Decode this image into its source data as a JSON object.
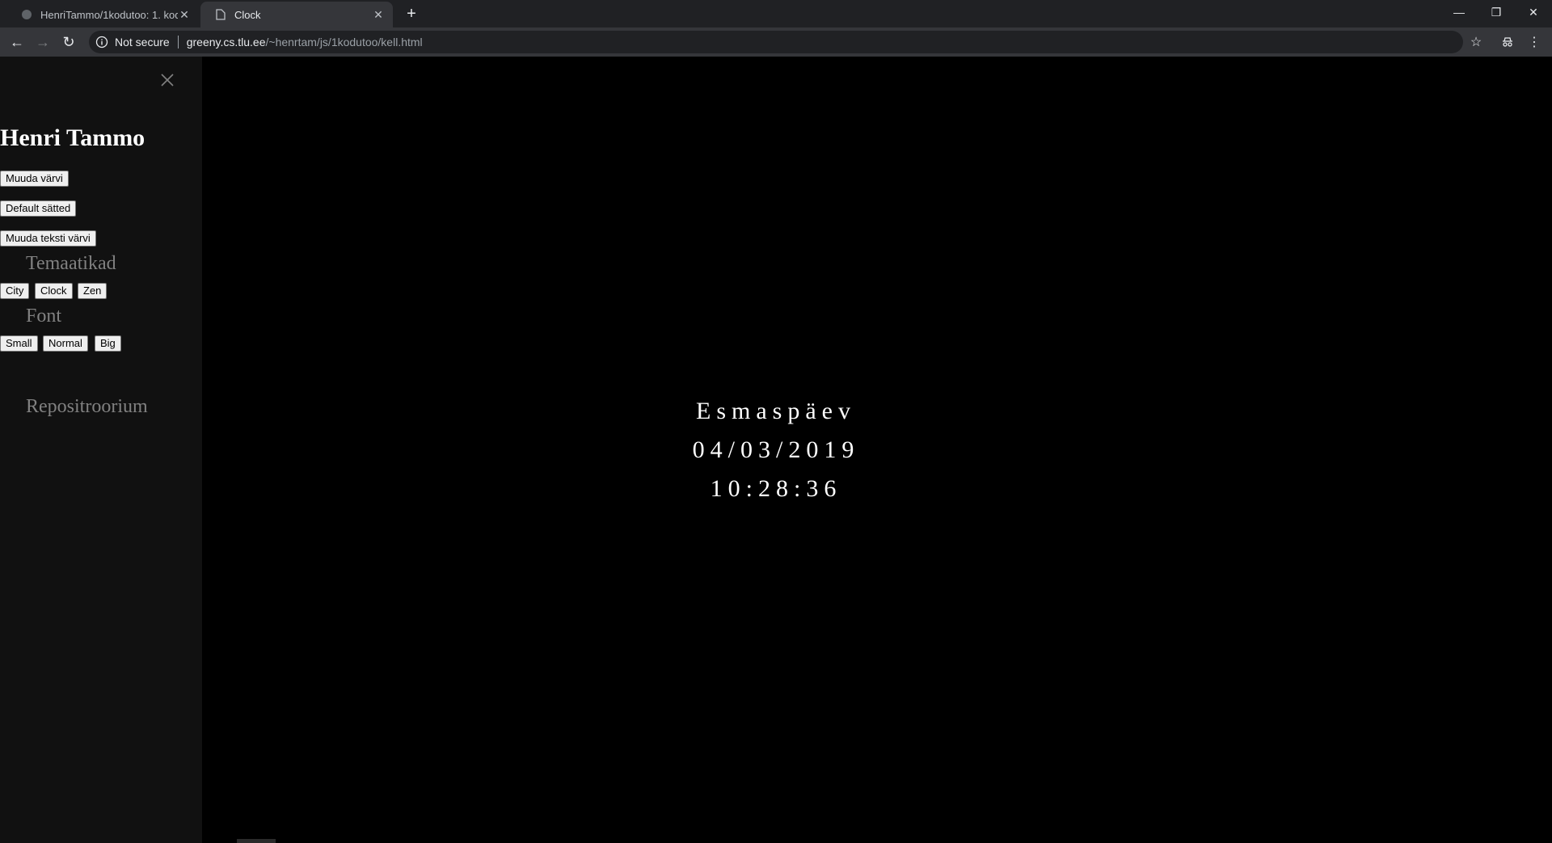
{
  "browser": {
    "tabs": [
      {
        "title": "HenriTammo/1kodutoo: 1. kodut",
        "active": false
      },
      {
        "title": "Clock",
        "active": true
      }
    ],
    "address": {
      "security": "Not secure",
      "host": "greeny.cs.tlu.ee",
      "path": "/~henrtam/js/1kodutoo/kell.html"
    }
  },
  "sidebar": {
    "name": "Henri Tammo",
    "buttons": {
      "change_color": "Muuda värvi",
      "default": "Default sätted",
      "change_text_color": "Muuda teksti värvi"
    },
    "themes_heading": "Temaatikad",
    "themes": [
      "City",
      "Clock",
      "Zen"
    ],
    "font_heading": "Font",
    "fonts": [
      "Small",
      "Normal",
      "Big"
    ],
    "repo_link": "Repositroorium"
  },
  "clock": {
    "day": "Esmaspäev",
    "date": "04/03/2019",
    "time": "10:28:36"
  },
  "colors": {
    "sidebar_bg": "#111111",
    "page_bg": "#000000",
    "muted_text": "#818181"
  }
}
